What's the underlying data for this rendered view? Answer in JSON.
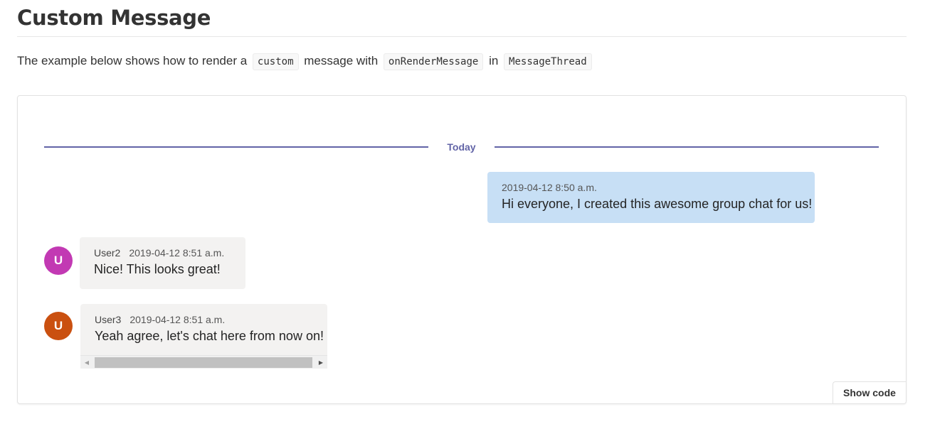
{
  "page": {
    "title": "Custom Message",
    "description": {
      "prefix": "The example below shows how to render a",
      "code1": "custom",
      "mid1": "message with",
      "code2": "onRenderMessage",
      "mid2": "in",
      "code3": "MessageThread"
    }
  },
  "thread": {
    "date_separator": "Today",
    "messages": [
      {
        "sender": "",
        "timestamp": "2019-04-12 8:50 a.m.",
        "text": "Hi everyone, I created this awesome group chat for us!",
        "mine": true
      },
      {
        "sender": "User2",
        "avatar_initial": "U",
        "avatar_color": "#c239b3",
        "timestamp": "2019-04-12 8:51 a.m.",
        "text": "Nice! This looks great!",
        "mine": false
      },
      {
        "sender": "User3",
        "avatar_initial": "U",
        "avatar_color": "#ca5010",
        "timestamp": "2019-04-12 8:51 a.m.",
        "text": "Yeah agree, let's chat here from now on!",
        "mine": false
      }
    ]
  },
  "controls": {
    "show_code_label": "Show code"
  },
  "colors": {
    "accent": "#6264a7",
    "mine_bubble": "#c7dff5",
    "other_bubble": "#f3f2f1"
  }
}
